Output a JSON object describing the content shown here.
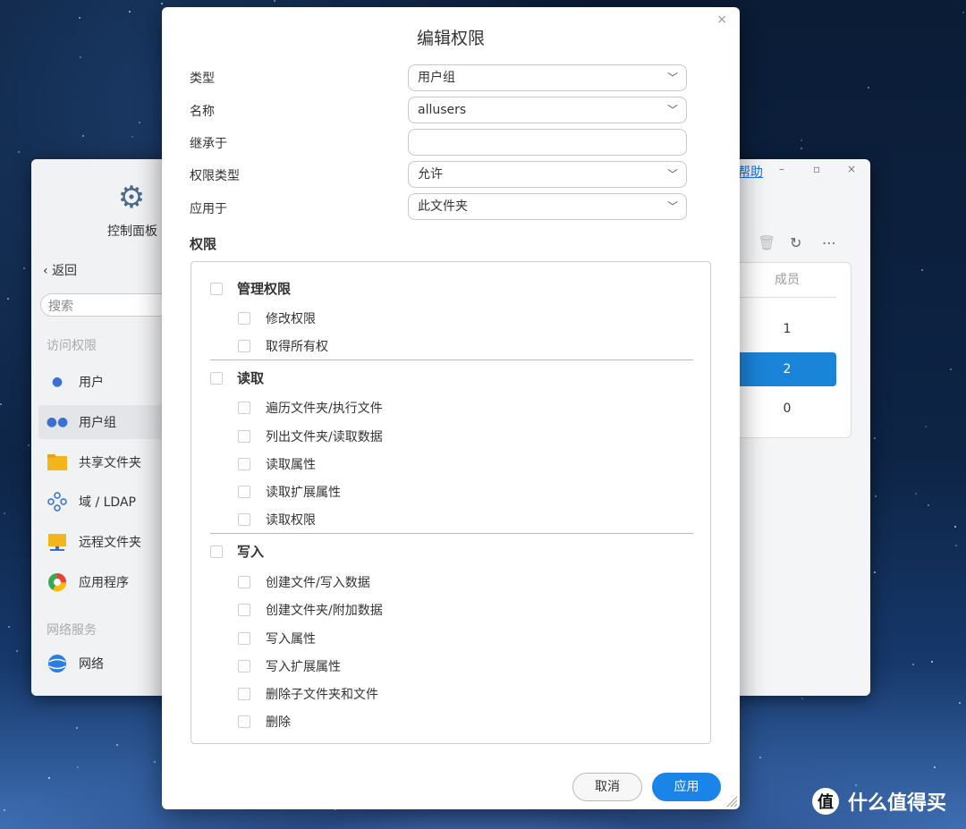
{
  "background_window": {
    "app_title": "控制面板",
    "back_label": "返回",
    "search_placeholder": "搜索",
    "help_label": "帮助",
    "sections": [
      "访问权限",
      "网络服务"
    ],
    "nav_items": [
      {
        "label": "用户",
        "icon": "user-icon"
      },
      {
        "label": "用户组",
        "icon": "user-group-icon",
        "active": true
      },
      {
        "label": "共享文件夹",
        "icon": "folder-icon"
      },
      {
        "label": "域 / LDAP",
        "icon": "domain-icon"
      },
      {
        "label": "远程文件夹",
        "icon": "remote-folder-icon"
      },
      {
        "label": "应用程序",
        "icon": "app-icon"
      },
      {
        "label": "网络",
        "icon": "network-icon"
      }
    ],
    "table": {
      "column_header": "成员",
      "rows": [
        "1",
        "2",
        "0"
      ],
      "selected_row_index": 1
    }
  },
  "dialog": {
    "title": "编辑权限",
    "fields": {
      "type": {
        "label": "类型",
        "value": "用户组"
      },
      "name": {
        "label": "名称",
        "value": "allusers"
      },
      "inherit": {
        "label": "继承于",
        "value": ""
      },
      "perm_type": {
        "label": "权限类型",
        "value": "允许"
      },
      "apply_to": {
        "label": "应用于",
        "value": "此文件夹"
      }
    },
    "permissions_heading": "权限",
    "groups": [
      {
        "label": "管理权限",
        "items": [
          "修改权限",
          "取得所有权"
        ]
      },
      {
        "label": "读取",
        "items": [
          "遍历文件夹/执行文件",
          "列出文件夹/读取数据",
          "读取属性",
          "读取扩展属性",
          "读取权限"
        ]
      },
      {
        "label": "写入",
        "items": [
          "创建文件/写入数据",
          "创建文件夹/附加数据",
          "写入属性",
          "写入扩展属性",
          "删除子文件夹和文件",
          "删除"
        ]
      }
    ],
    "cancel_label": "取消",
    "apply_label": "应用"
  },
  "watermark": {
    "text": "什么值得买",
    "logo_glyph": "值"
  },
  "colors": {
    "accent": "#1a84e8",
    "selected_row": "#1a84d8"
  }
}
